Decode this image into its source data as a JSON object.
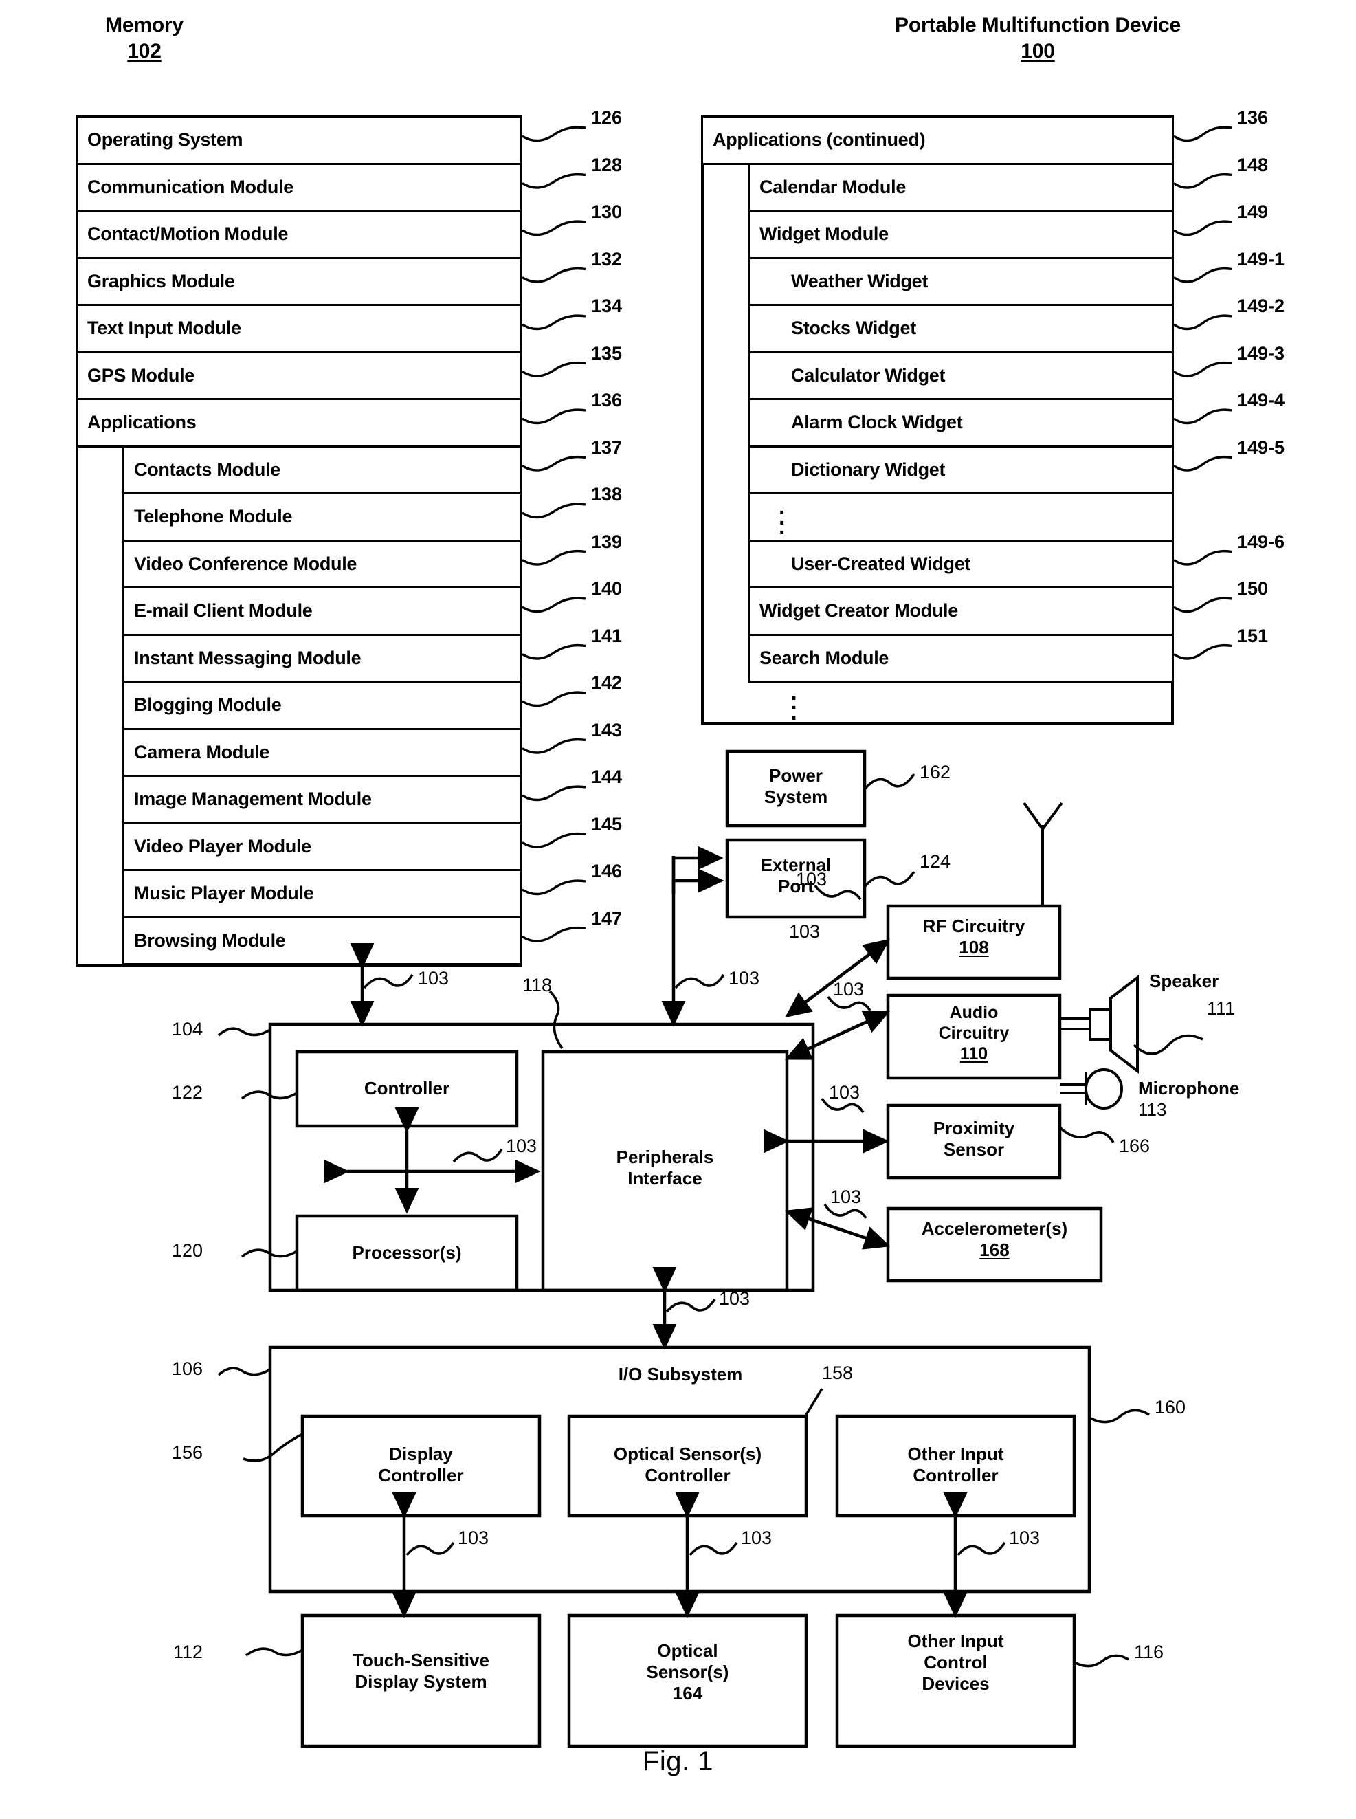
{
  "figure": {
    "caption": "Fig. 1"
  },
  "memory_column": {
    "title": "Memory",
    "ref": "102",
    "rows": [
      {
        "label": "Operating System",
        "ref": "126",
        "indent": 0
      },
      {
        "label": "Communication Module",
        "ref": "128",
        "indent": 0
      },
      {
        "label": "Contact/Motion Module",
        "ref": "130",
        "indent": 0
      },
      {
        "label": "Graphics Module",
        "ref": "132",
        "indent": 0
      },
      {
        "label": "Text Input Module",
        "ref": "134",
        "indent": 0
      },
      {
        "label": "GPS Module",
        "ref": "135",
        "indent": 0
      },
      {
        "label": "Applications",
        "ref": "136",
        "indent": 0
      },
      {
        "label": "Contacts Module",
        "ref": "137",
        "indent": 1
      },
      {
        "label": "Telephone Module",
        "ref": "138",
        "indent": 1
      },
      {
        "label": "Video Conference Module",
        "ref": "139",
        "indent": 1
      },
      {
        "label": "E-mail Client Module",
        "ref": "140",
        "indent": 1
      },
      {
        "label": "Instant Messaging Module",
        "ref": "141",
        "indent": 1
      },
      {
        "label": "Blogging Module",
        "ref": "142",
        "indent": 1
      },
      {
        "label": "Camera Module",
        "ref": "143",
        "indent": 1
      },
      {
        "label": "Image Management Module",
        "ref": "144",
        "indent": 1
      },
      {
        "label": "Video Player Module",
        "ref": "145",
        "indent": 1
      },
      {
        "label": "Music Player Module",
        "ref": "146",
        "indent": 1
      },
      {
        "label": "Browsing Module",
        "ref": "147",
        "indent": 1
      }
    ]
  },
  "device_column": {
    "title": "Portable Multifunction Device",
    "ref": "100",
    "rows": [
      {
        "label": "Applications (continued)",
        "ref": "136",
        "indent": 0,
        "dots": false
      },
      {
        "label": "Calendar Module",
        "ref": "148",
        "indent": 1,
        "dots": false
      },
      {
        "label": "Widget Module",
        "ref": "149",
        "indent": 1,
        "dots": false
      },
      {
        "label": "Weather Widget",
        "ref": "149-1",
        "indent": 2,
        "dots": false
      },
      {
        "label": "Stocks Widget",
        "ref": "149-2",
        "indent": 2,
        "dots": false
      },
      {
        "label": "Calculator Widget",
        "ref": "149-3",
        "indent": 2,
        "dots": false
      },
      {
        "label": "Alarm Clock Widget",
        "ref": "149-4",
        "indent": 2,
        "dots": false
      },
      {
        "label": "Dictionary Widget",
        "ref": "149-5",
        "indent": 2,
        "dots": false
      },
      {
        "label": "",
        "ref": "",
        "indent": 2,
        "dots": true
      },
      {
        "label": "User-Created Widget",
        "ref": "149-6",
        "indent": 2,
        "dots": false
      },
      {
        "label": "Widget Creator Module",
        "ref": "150",
        "indent": 1,
        "dots": false
      },
      {
        "label": "Search Module",
        "ref": "151",
        "indent": 1,
        "dots": false
      }
    ],
    "trailing_dots": true
  },
  "blocks": {
    "power_system": {
      "label": "Power\nSystem",
      "ref": "162"
    },
    "external_port": {
      "label": "External\nPort",
      "ref": "124"
    },
    "rf_circuitry": {
      "label": "RF Circuitry",
      "ref": "108"
    },
    "audio_circuitry": {
      "label": "Audio\nCircuitry",
      "ref": "110"
    },
    "proximity_sensor": {
      "label": "Proximity\nSensor",
      "ref": "166"
    },
    "accelerometers": {
      "label": "Accelerometer(s)",
      "ref": "168"
    },
    "controller": {
      "label": "Controller",
      "ref": "122"
    },
    "processors": {
      "label": "Processor(s)",
      "ref": "120"
    },
    "peripherals": {
      "label": "Peripherals\nInterface",
      "ref": "118"
    },
    "cpu_enclosure": {
      "ref": "104"
    },
    "io_subsystem": {
      "label": "I/O Subsystem",
      "ref": "106"
    },
    "display_controller": {
      "label": "Display\nController",
      "ref": "156"
    },
    "optical_sensor_controller": {
      "label": "Optical Sensor(s)\nController",
      "ref": "158"
    },
    "other_input_controller": {
      "label": "Other Input\nController",
      "ref": "160"
    },
    "touch_display": {
      "label": "Touch-Sensitive\nDisplay System",
      "ref": "112"
    },
    "optical_sensors": {
      "label": "Optical\nSensor(s)",
      "ref": "164"
    },
    "other_input_devices": {
      "label": "Other Input\nControl\nDevices",
      "ref": "116"
    },
    "speaker": {
      "label": "Speaker",
      "ref": "111"
    },
    "microphone": {
      "label": "Microphone",
      "ref": "113"
    }
  },
  "bus_label": "103",
  "bus_labels": [
    "103",
    "103",
    "103",
    "103",
    "103",
    "103",
    "103",
    "103",
    "103",
    "103",
    "103"
  ]
}
